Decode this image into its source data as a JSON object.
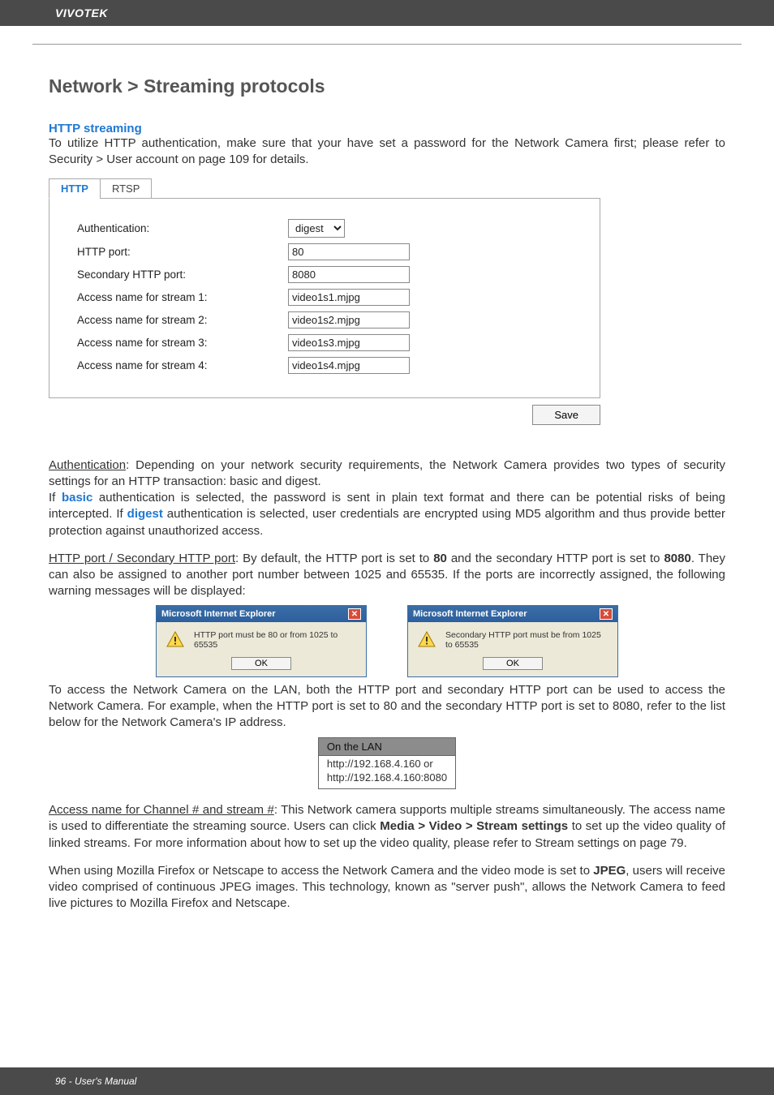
{
  "header": {
    "brand": "VIVOTEK"
  },
  "section_title": "Network > Streaming protocols",
  "http_streaming": {
    "heading": "HTTP streaming",
    "intro_1": "To utilize HTTP authentication, make sure that your have set a password for the Network Camera first; please refer to Security > User account on page 109 for details."
  },
  "tabs": {
    "http": "HTTP",
    "rtsp": "RTSP"
  },
  "form": {
    "authentication": {
      "label": "Authentication:",
      "value": "digest"
    },
    "http_port": {
      "label": "HTTP port:",
      "value": "80"
    },
    "secondary_port": {
      "label": "Secondary HTTP port:",
      "value": "8080"
    },
    "stream1": {
      "label": "Access name for stream 1:",
      "value": "video1s1.mjpg"
    },
    "stream2": {
      "label": "Access name for stream 2:",
      "value": "video1s2.mjpg"
    },
    "stream3": {
      "label": "Access name for stream 3:",
      "value": "video1s3.mjpg"
    },
    "stream4": {
      "label": "Access name for stream 4:",
      "value": "video1s4.mjpg"
    },
    "save_label": "Save"
  },
  "auth_para": {
    "lead": "Authentication",
    "rest_1": ": Depending on your network security requirements, the Network Camera provides two types of security settings for an HTTP transaction: basic and digest.",
    "line2a": "If ",
    "basic": "basic",
    "line2b": " authentication is selected, the password is sent in plain text format and there can be potential risks of being intercepted. If ",
    "digest": "digest",
    "line2c": " authentication is selected, user credentials are encrypted using MD5 algorithm and thus provide better protection against unauthorized access."
  },
  "port_para": {
    "lead": "HTTP port / Secondary HTTP port",
    "rest_a": ": By default, the HTTP port is set to ",
    "p80": "80",
    "rest_b": " and the secondary HTTP port is set to ",
    "p8080": "8080",
    "rest_c": ". They can also be assigned to another port number between 1025 and 65535. If the ports are incorrectly assigned, the following warning messages will be displayed:"
  },
  "dialog1": {
    "title": "Microsoft Internet Explorer",
    "msg": "HTTP port must be 80 or from 1025 to 65535",
    "ok": "OK"
  },
  "dialog2": {
    "title": "Microsoft Internet Explorer",
    "msg": "Secondary HTTP port must be from 1025 to 65535",
    "ok": "OK"
  },
  "lan_intro": "To access the Network Camera on the LAN, both the HTTP port and secondary HTTP port can be used to access the Network Camera. For example, when the HTTP port is set to 80 and the secondary HTTP port is set to 8080, refer to the list below for the Network Camera's IP address.",
  "lan_table": {
    "header": "On the LAN",
    "row1": "http://192.168.4.160  or",
    "row2": "http://192.168.4.160:8080"
  },
  "access_para": {
    "lead": "Access name for Channel # and stream #",
    "rest_a": ": This Network camera supports multiple streams simultaneously. The access name is used to differentiate the streaming source. Users can click ",
    "media": "Media > Video > Stream settings",
    "rest_b": " to set up the video quality of linked streams. For more information about how to set up the video quality, please refer to Stream settings on page 79."
  },
  "jpeg_para": {
    "text_a": "When using Mozilla Firefox or Netscape to access the Network Camera and the video mode is set to ",
    "jpeg": "JPEG",
    "text_b": ", users will receive video comprised of continuous JPEG images. This technology, known as \"server push\", allows the Network Camera to feed live pictures to Mozilla Firefox and Netscape."
  },
  "footer": {
    "text": "96 - User's Manual"
  }
}
